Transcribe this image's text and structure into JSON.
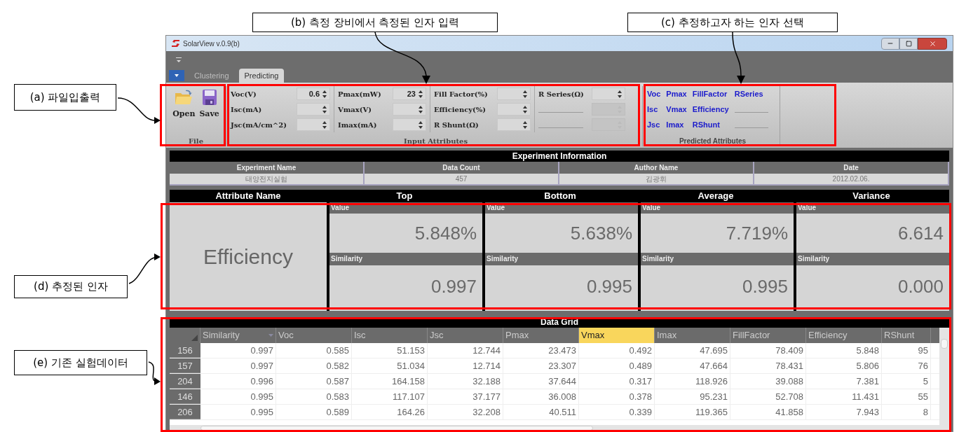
{
  "annotations": [
    {
      "text": "(a) 파일입출력"
    },
    {
      "text": "(b) 측정 장비에서 측정된 인자 입력"
    },
    {
      "text": "(c) 추정하고자 하는 인자 선택"
    },
    {
      "text": "(d) 추정된 인자"
    },
    {
      "text": "(e) 기존 실험데이터"
    }
  ],
  "window": {
    "title": "SolarView v.0.9(b)"
  },
  "tabs": [
    {
      "label": "Clustering",
      "selected": false
    },
    {
      "label": "Predicting",
      "selected": true
    }
  ],
  "ribbon": {
    "file_group": {
      "title": "File",
      "buttons": [
        {
          "kind": "open",
          "label": "Open"
        },
        {
          "kind": "save",
          "label": "Save"
        }
      ]
    },
    "input_group": {
      "title": "Input Attributes",
      "columns": [
        [
          {
            "kind": "spinner",
            "label": "Voc(V)",
            "value": "0.6"
          },
          {
            "kind": "spinner",
            "label": "Isc(mA)"
          },
          {
            "kind": "spinner",
            "label": "Jsc(mA/cm^2)"
          }
        ],
        [
          {
            "kind": "spinner",
            "label": "Pmax(mW)",
            "value": "23"
          },
          {
            "kind": "spinner",
            "label": "Vmax(V)"
          },
          {
            "kind": "spinner",
            "label": "Imax(mA)"
          }
        ],
        [
          {
            "kind": "spinner",
            "label": "Fill Factor(%)"
          },
          {
            "kind": "spinner",
            "label": "Efficiency(%)"
          },
          {
            "kind": "spinner",
            "label": "R Shunt(Ω)"
          }
        ],
        [
          {
            "kind": "spinner",
            "label": "R Series(Ω)"
          },
          {
            "kind": "blank"
          },
          {
            "kind": "blank"
          }
        ]
      ]
    },
    "predicted_group": {
      "title": "Predicted Attributes",
      "columns": [
        [
          {
            "kind": "link",
            "label": "Voc"
          },
          {
            "kind": "link",
            "label": "Isc"
          },
          {
            "kind": "link",
            "label": "Jsc"
          }
        ],
        [
          {
            "kind": "link",
            "label": "Pmax"
          },
          {
            "kind": "link",
            "label": "Vmax"
          },
          {
            "kind": "link",
            "label": "Imax"
          }
        ],
        [
          {
            "kind": "link",
            "label": "FillFactor"
          },
          {
            "kind": "link",
            "label": "Efficiency"
          },
          {
            "kind": "link",
            "label": "RShunt"
          }
        ],
        [
          {
            "kind": "link",
            "label": "RSeries"
          },
          {
            "kind": "blank"
          },
          {
            "kind": "blank"
          }
        ]
      ]
    }
  },
  "experiment_information": {
    "title": "Experiment Information",
    "columns": [
      "Experiment Name",
      "Data Count",
      "Author Name",
      "Date"
    ],
    "values": [
      "태양전지실험",
      "457",
      "김광휘",
      "2012.02.06."
    ]
  },
  "results": {
    "columns": [
      "Attribute Name",
      "Top",
      "Bottom",
      "Average",
      "Variance"
    ],
    "attribute": "Efficiency",
    "cards": [
      {
        "value_label": "Value",
        "value": "5.848%",
        "similarity_label": "Similarity",
        "similarity": "0.997"
      },
      {
        "value_label": "Value",
        "value": "5.638%",
        "similarity_label": "Similarity",
        "similarity": "0.995"
      },
      {
        "value_label": "Value",
        "value": "7.719%",
        "similarity_label": "Similarity",
        "similarity": "0.995"
      },
      {
        "value_label": "Value",
        "value": "6.614",
        "similarity_label": "Similarity",
        "similarity": "0.000"
      }
    ]
  },
  "data_grid": {
    "title": "Data Grid",
    "columns": [
      {
        "label": "Similarity",
        "selected": false,
        "sorted": true
      },
      {
        "label": "Voc",
        "selected": false,
        "sorted": false
      },
      {
        "label": "Isc",
        "selected": false,
        "sorted": false
      },
      {
        "label": "Jsc",
        "selected": false,
        "sorted": false
      },
      {
        "label": "Pmax",
        "selected": false,
        "sorted": false
      },
      {
        "label": "Vmax",
        "selected": true,
        "sorted": false
      },
      {
        "label": "Imax",
        "selected": false,
        "sorted": false
      },
      {
        "label": "FillFactor",
        "selected": false,
        "sorted": false
      },
      {
        "label": "Efficiency",
        "selected": false,
        "sorted": false
      },
      {
        "label": "RShunt",
        "selected": false,
        "sorted": false
      }
    ],
    "rows": [
      {
        "header": "156",
        "cells": [
          "0.997",
          "0.585",
          "51.153",
          "12.744",
          "23.473",
          "0.492",
          "47.695",
          "78.409",
          "5.848",
          "95"
        ]
      },
      {
        "header": "157",
        "cells": [
          "0.997",
          "0.582",
          "51.034",
          "12.714",
          "23.307",
          "0.489",
          "47.664",
          "78.431",
          "5.806",
          "76"
        ]
      },
      {
        "header": "204",
        "cells": [
          "0.996",
          "0.587",
          "164.158",
          "32.188",
          "37.644",
          "0.317",
          "118.926",
          "39.088",
          "7.381",
          "5"
        ]
      },
      {
        "header": "146",
        "cells": [
          "0.995",
          "0.583",
          "117.107",
          "37.177",
          "36.008",
          "0.378",
          "95.231",
          "52.708",
          "11.431",
          "55"
        ]
      },
      {
        "header": "206",
        "cells": [
          "0.995",
          "0.589",
          "164.26",
          "32.208",
          "40.511",
          "0.339",
          "119.365",
          "41.858",
          "7.943",
          "8"
        ]
      }
    ]
  }
}
